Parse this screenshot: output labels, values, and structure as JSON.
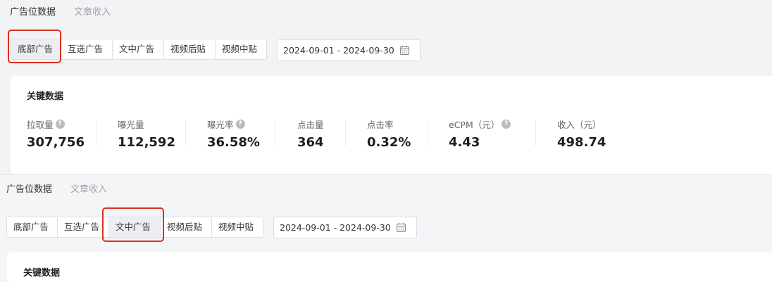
{
  "panel1": {
    "top_tabs": [
      "广告位数据",
      "文章收入"
    ],
    "ad_slots": [
      "底部广告",
      "互选广告",
      "文中广告",
      "视频后贴",
      "视频中贴"
    ],
    "active_slot": "底部广告",
    "date_range": "2024-09-01 - 2024-09-30",
    "card_title": "关键数据",
    "metrics": [
      {
        "label": "拉取量",
        "value": "307,756",
        "help": true
      },
      {
        "label": "曝光量",
        "value": "112,592",
        "help": false
      },
      {
        "label": "曝光率",
        "value": "36.58%",
        "help": true
      },
      {
        "label": "点击量",
        "value": "364",
        "help": false
      },
      {
        "label": "点击率",
        "value": "0.32%",
        "help": false
      },
      {
        "label": "eCPM（元）",
        "value": "4.43",
        "help": true
      },
      {
        "label": "收入（元）",
        "value": "498.74",
        "help": false
      }
    ]
  },
  "panel2": {
    "top_tabs": [
      "广告位数据",
      "文章收入"
    ],
    "ad_slots": [
      "底部广告",
      "互选广告",
      "文中广告",
      "视频后贴",
      "视频中贴"
    ],
    "active_slot": "文中广告",
    "date_range": "2024-09-01 - 2024-09-30",
    "card_title": "关键数据"
  },
  "colors": {
    "highlight": "#d9301f",
    "background": "#f2f3f5",
    "card": "#ffffff",
    "help_icon": "#b8bbc0"
  },
  "icons": {
    "help": "question-circle-icon",
    "calendar": "calendar-icon"
  }
}
